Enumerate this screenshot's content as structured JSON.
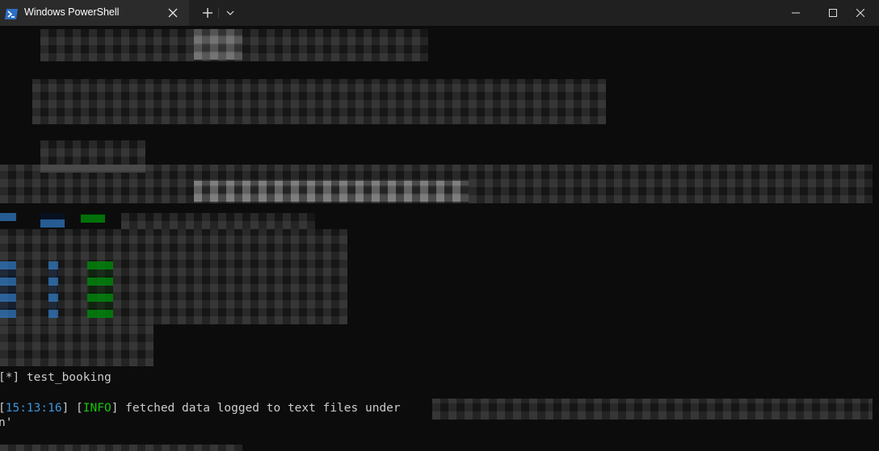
{
  "window": {
    "tab_title": "Windows PowerShell"
  },
  "colors": {
    "background": "#0c0c0c",
    "titlebar": "#202020",
    "tab_active": "#2b2b2b",
    "text": "#cccccc",
    "timestamp": "#3a96dd",
    "info": "#16c60c"
  },
  "icons": {
    "tab": "powershell-icon",
    "close": "close-icon",
    "new_tab": "plus-icon",
    "dropdown": "chevron-down-icon",
    "minimize": "minimize-icon",
    "maximize": "maximize-icon",
    "window_close": "window-close-icon"
  },
  "terminal": {
    "line_test": {
      "bracket_open": "[",
      "marker": "*",
      "bracket_close": "]",
      "text": " test_booking"
    },
    "line_log": {
      "bracket_open": "[",
      "timestamp": "15:13:16",
      "bracket_mid": "] [",
      "level": "INFO",
      "bracket_close": "]",
      "message": " fetched data logged to text files under"
    },
    "line_cont": "n'"
  }
}
